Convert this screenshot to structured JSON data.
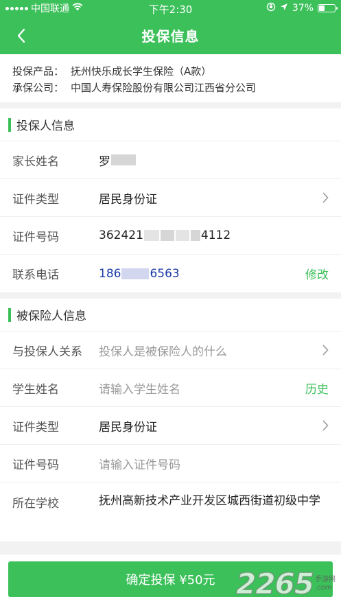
{
  "status_bar": {
    "carrier": "中国联通",
    "time": "下午2:30",
    "battery": "37%",
    "battery_level": 0.37
  },
  "nav": {
    "title": "投保信息"
  },
  "product": {
    "product_label": "投保产品：",
    "product_value": "抚州快乐成长学生保险（A款）",
    "insurer_label": "承保公司：",
    "insurer_value": "中国人寿保险股份有限公司江西省分公司"
  },
  "applicant": {
    "title": "投保人信息",
    "rows": [
      {
        "label": "家长姓名",
        "value": "罗"
      },
      {
        "label": "证件类型",
        "value": "居民身份证"
      },
      {
        "label": "证件号码",
        "value_start": "362421",
        "value_end": "4112"
      },
      {
        "label": "联系电话",
        "value_start": "186",
        "value_end": "6563",
        "action": "修改"
      }
    ]
  },
  "insured": {
    "title": "被保险人信息",
    "rows": [
      {
        "label": "与投保人关系",
        "placeholder": "投保人是被保险人的什么"
      },
      {
        "label": "学生姓名",
        "placeholder": "请输入学生姓名",
        "action": "历史"
      },
      {
        "label": "证件类型",
        "value": "居民身份证"
      },
      {
        "label": "证件号码",
        "placeholder": "请输入证件号码"
      },
      {
        "label": "所在学校",
        "value": "抚州高新技术产业开发区城西街道初级中学"
      }
    ]
  },
  "submit": {
    "label": "确定投保 ¥50元"
  },
  "watermark": {
    "number": "2265",
    "suffix": ".com",
    "site_name": "手游网"
  },
  "colors": {
    "accent": "#3cc05a",
    "link": "#1a3aa8"
  },
  "icons": {
    "back": "chevron-left-icon",
    "disclosure": "chevron-right-icon"
  }
}
